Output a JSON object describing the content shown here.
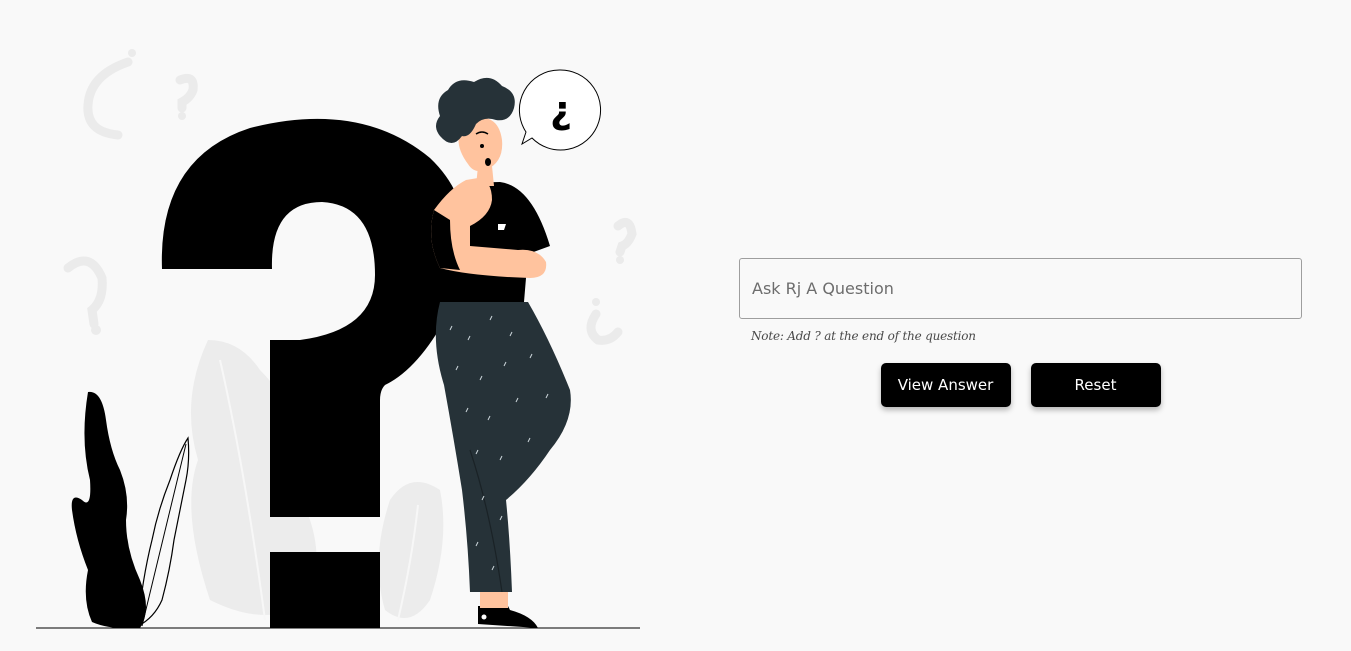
{
  "form": {
    "input_placeholder": "Ask Rj A Question",
    "input_value": "",
    "note": "Note: Add ? at the end of the question",
    "view_answer_label": "View Answer",
    "reset_label": "Reset"
  },
  "illustration": {
    "icon": "thinking-person-question-mark-illustration",
    "speech_bubble_text": "¿",
    "colors": {
      "primary": "#000000",
      "skin": "#ffc39e",
      "hair": "#263238",
      "pants": "#263238",
      "ghost": "#ebebeb"
    }
  },
  "colors": {
    "background": "#f9f9f9",
    "button_bg": "#000000",
    "button_text": "#ffffff",
    "input_border": "#9e9e9e"
  }
}
